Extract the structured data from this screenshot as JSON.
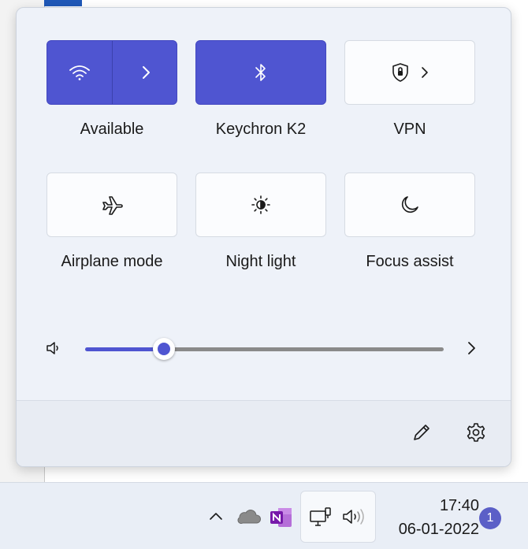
{
  "quick_settings": {
    "tiles": [
      {
        "id": "wifi",
        "label": "Available",
        "icon": "wifi-icon",
        "active": true,
        "expandable": true
      },
      {
        "id": "bluetooth",
        "label": "Keychron K2",
        "icon": "bluetooth-icon",
        "active": true,
        "expandable": false
      },
      {
        "id": "vpn",
        "label": "VPN",
        "icon": "shield-lock-icon",
        "active": false,
        "expandable": true
      },
      {
        "id": "airplane",
        "label": "Airplane mode",
        "icon": "airplane-icon",
        "active": false,
        "expandable": false
      },
      {
        "id": "night-light",
        "label": "Night light",
        "icon": "brightness-icon",
        "active": false,
        "expandable": false
      },
      {
        "id": "focus",
        "label": "Focus assist",
        "icon": "moon-icon",
        "active": false,
        "expandable": false
      }
    ],
    "volume": {
      "icon": "speaker-icon",
      "level": 0.22
    },
    "footer": {
      "edit_icon": "pencil-icon",
      "settings_icon": "gear-icon"
    }
  },
  "taskbar": {
    "tray_icons": [
      "chevron-up-icon",
      "onedrive-icon",
      "onenote-icon",
      "network-icon",
      "speaker-icon"
    ],
    "time": "17:40",
    "date": "06-01-2022",
    "notification_count": "1"
  },
  "colors": {
    "accent": "#4f55d1",
    "panel_bg": "#eef2f9",
    "badge": "#5b5fc7"
  }
}
